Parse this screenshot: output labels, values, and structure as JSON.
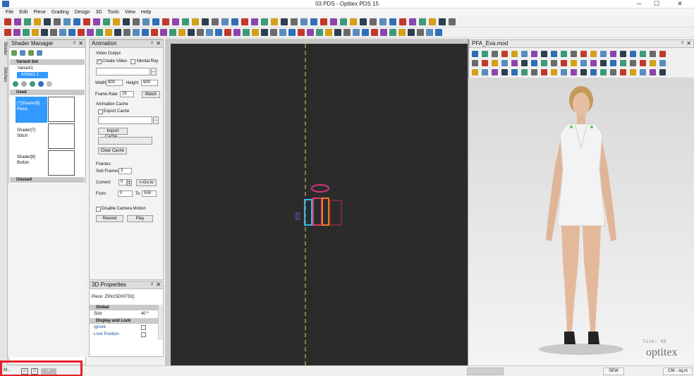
{
  "window": {
    "title": "03.PDS - Optitex PDS 15",
    "min_label": "─",
    "max_label": "☐",
    "close_label": "✕"
  },
  "menu": [
    "File",
    "Edit",
    "Piece",
    "Grading",
    "Design",
    "3D",
    "Tools",
    "View",
    "Help"
  ],
  "side_tabs": [
    "Shader",
    "Stitches"
  ],
  "shader_manager": {
    "title": "Shader Manager",
    "variant_set_label": "Variant Set",
    "variant": "Variant1",
    "article": "Article1.1",
    "used_label": "Used",
    "unused_label": "Unused",
    "shaders": [
      {
        "name": "(*)Shader[6]",
        "type": "Piece"
      },
      {
        "name": "Shader[7]",
        "type": "Stitch"
      },
      {
        "name": "Shader[8]",
        "type": "Button"
      }
    ]
  },
  "animation": {
    "title": "Animation",
    "video_output_label": "Video Output",
    "create_video_label": "Create Video",
    "create_video_checked": true,
    "mental_ray_label": "Mental Ray",
    "mental_ray_checked": false,
    "width_label": "Width",
    "width_value": "800",
    "height_label": "Height",
    "height_value": "600",
    "frame_rate_label": "Frame Rate",
    "frame_rate_value": "29",
    "watch_label": "Watch",
    "cache_label": "Animation Cache",
    "export_cache_label": "Export Cache",
    "import_cache_label": "Import Cache...",
    "clear_cache_label": "Clear Cache",
    "frames_label": "Frames:",
    "sub_frames_label": "Sub Frames",
    "sub_frames_value": "3",
    "current_label": "Current:",
    "current_value": "0",
    "goto_label": "<-Go to",
    "from_label": "From",
    "from_value": "0",
    "to_label": "To",
    "to_value": "558",
    "disable_camera_label": "Disable Camera Motion",
    "rewind_label": "Rewind",
    "play_label": "Play"
  },
  "props3d": {
    "title": "3D Properties",
    "piece_label": "Piece: Z5N1SD00TDQ",
    "global_label": "Global",
    "size_label": "Size",
    "size_value": "40 *",
    "display_lock_label": "Display and Lock",
    "ignore_label": "Ignore",
    "lock_position_label": "Lock Position"
  },
  "view3d": {
    "title": "PFA_Eva.mod",
    "size_label": "Size: 40",
    "brand": "optitex"
  },
  "bottom_tab": {
    "label": "M..."
  },
  "status": {
    "mode": "SEW",
    "units": "CM - sq.m"
  },
  "colors": {
    "accent": "#3399ff",
    "canvas": "#2b2b2b",
    "highlight_box": "#e5202a"
  }
}
